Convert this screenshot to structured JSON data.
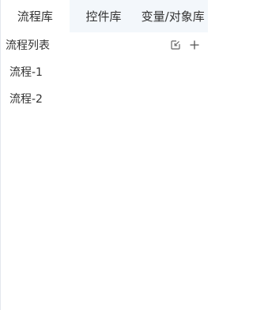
{
  "tabs": [
    {
      "label": "流程库",
      "active": true
    },
    {
      "label": "控件库",
      "active": false
    },
    {
      "label": "变量/对象库",
      "active": false
    }
  ],
  "list": {
    "title": "流程列表",
    "icons": [
      "import-icon",
      "add-icon"
    ],
    "items": [
      {
        "label": "流程-1"
      },
      {
        "label": "流程-2"
      }
    ]
  },
  "colors": {
    "tab_bar_bg": "#f3f7fb",
    "active_tab_bg": "#ffffff",
    "text": "#333333",
    "border": "#e4e7ed",
    "icon": "#666666"
  }
}
